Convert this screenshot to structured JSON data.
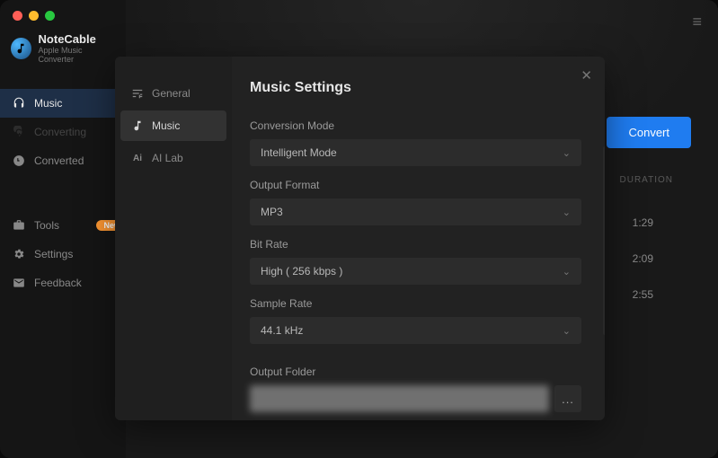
{
  "brand": {
    "title": "NoteCable",
    "subtitle": "Apple Music Converter"
  },
  "sidebar": {
    "music": "Music",
    "converting": "Converting",
    "converted": "Converted",
    "tools": "Tools",
    "tools_badge": "New",
    "settings": "Settings",
    "feedback": "Feedback"
  },
  "hero": {
    "convert_btn": "Convert",
    "duration_header": "DURATION",
    "durations": [
      "1:29",
      "2:09",
      "2:55"
    ]
  },
  "modal": {
    "close": "✕",
    "tabs": {
      "general": "General",
      "music": "Music",
      "ai_lab": "AI Lab"
    },
    "title": "Music Settings",
    "fields": {
      "conversion_mode": {
        "label": "Conversion Mode",
        "value": "Intelligent Mode"
      },
      "output_format": {
        "label": "Output Format",
        "value": "MP3"
      },
      "bit_rate": {
        "label": "Bit Rate",
        "value": "High ( 256 kbps )"
      },
      "sample_rate": {
        "label": "Sample Rate",
        "value": "44.1 kHz"
      },
      "output_folder": {
        "label": "Output Folder",
        "browse": "..."
      }
    }
  }
}
